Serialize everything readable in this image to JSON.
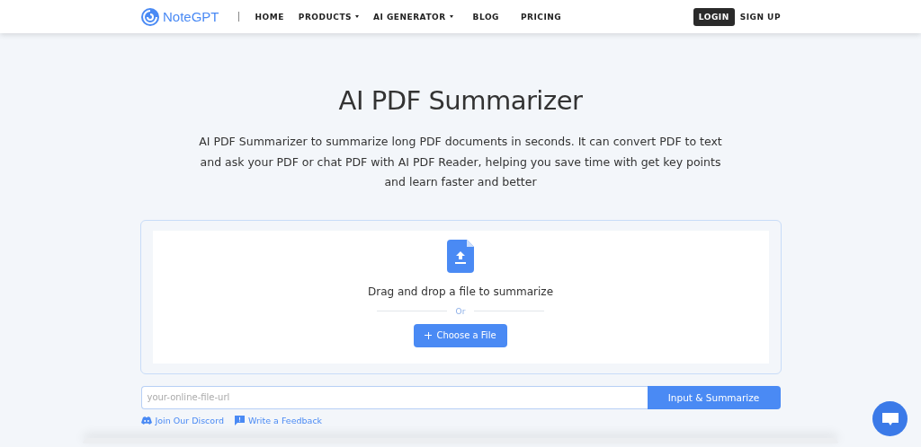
{
  "header": {
    "logo": "NoteGPT",
    "nav": [
      {
        "label": "HOME",
        "has_menu": false
      },
      {
        "label": "PRODUCTS",
        "has_menu": true
      },
      {
        "label": "AI GENERATOR",
        "has_menu": true
      },
      {
        "label": "BLOG",
        "has_menu": false
      },
      {
        "label": "PRICING",
        "has_menu": false
      }
    ],
    "login": "LOGIN",
    "signup": "SIGN UP"
  },
  "title": "AI PDF Summarizer",
  "description": "AI PDF Summarizer to summarize long PDF documents in seconds. It can convert PDF to text and ask your PDF or chat PDF with AI PDF Reader, helping you save time with get key points and learn faster and better",
  "upload": {
    "prompt": "Drag and drop a file to summarize",
    "divider": "Or",
    "button": "Choose a File"
  },
  "url_form": {
    "placeholder": "your-online-file-url",
    "button": "Input & Summarize"
  },
  "links": [
    {
      "kind": "discord",
      "label": "Join Our Discord"
    },
    {
      "kind": "feedback",
      "label": "Write a Feedback"
    }
  ]
}
